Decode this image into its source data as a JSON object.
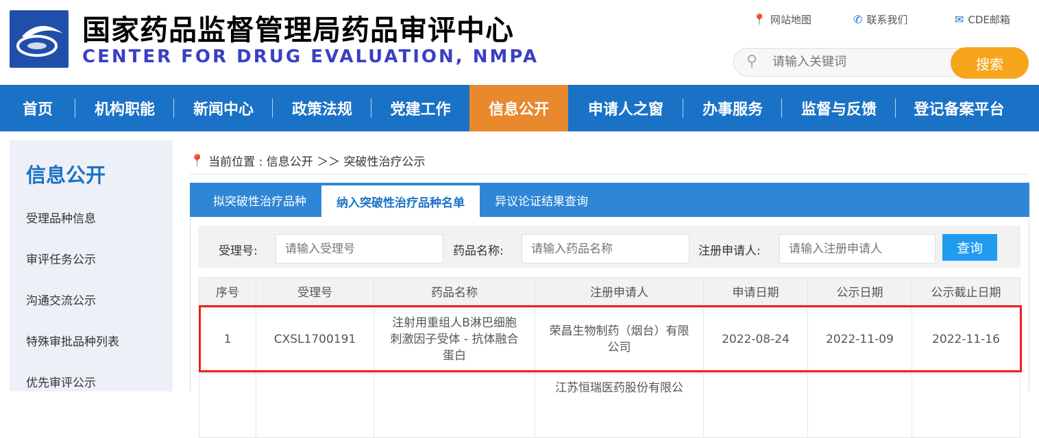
{
  "header": {
    "title_cn": "国家药品监督管理局药品审评中心",
    "title_en": "CENTER FOR DRUG EVALUATION, NMPA",
    "links": [
      {
        "label": "网站地图",
        "icon": "location-pin-icon"
      },
      {
        "label": "联系我们",
        "icon": "phone-icon"
      },
      {
        "label": "CDE邮箱",
        "icon": "mail-icon"
      }
    ],
    "search": {
      "placeholder": "请输入关键词",
      "button": "搜索"
    }
  },
  "nav": [
    "首页",
    "机构职能",
    "新闻中心",
    "政策法规",
    "党建工作",
    "信息公开",
    "申请人之窗",
    "办事服务",
    "监督与反馈",
    "登记备案平台"
  ],
  "nav_active": "信息公开",
  "sidebar": {
    "title": "信息公开",
    "items": [
      "受理品种信息",
      "审评任务公示",
      "沟通交流公示",
      "特殊审批品种列表",
      "优先审评公示"
    ]
  },
  "breadcrumb": "当前位置 : 信息公开 ＞＞ 突破性治疗公示",
  "tabs": [
    "拟突破性治疗品种",
    "纳入突破性治疗品种名单",
    "异议论证结果查询"
  ],
  "filter": {
    "labels": [
      "受理号:",
      "药品名称:",
      "注册申请人:"
    ],
    "placeholders": [
      "请输入受理号",
      "请输入药品名称",
      "请输入注册申请人"
    ],
    "button": "查询"
  },
  "table": {
    "headers": [
      "序号",
      "受理号",
      "药品名称",
      "注册申请人",
      "申请日期",
      "公示日期",
      "公示截止日期"
    ],
    "rows": [
      [
        "1",
        "CXSL1700191",
        "注射用重组人B淋巴细胞刺激因子受体 - 抗体融合蛋白",
        "荣昌生物制药（烟台）有限公司",
        "2022-08-24",
        "2022-11-09",
        "2022-11-16"
      ],
      [
        "",
        "",
        "",
        "江苏恒瑞医药股份有限公",
        "",
        "",
        ""
      ]
    ]
  },
  "colors": {
    "nav": "#1a72c7",
    "active": "#e8892e",
    "search_btn": "#f7a51c",
    "highlight": "#f21c1c"
  }
}
